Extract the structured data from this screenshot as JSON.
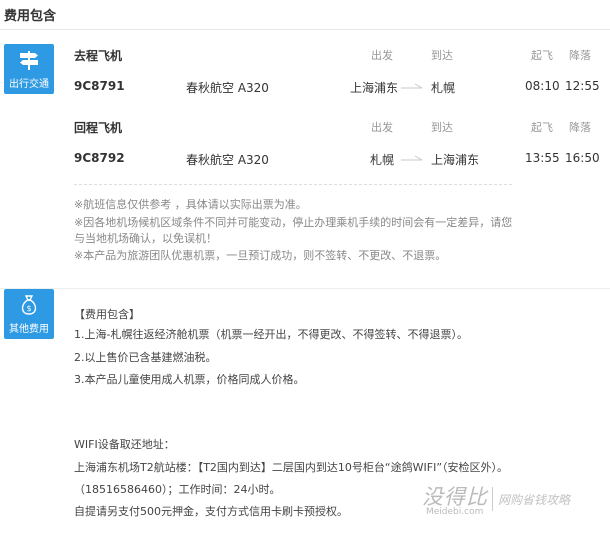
{
  "section": {
    "title": "费用包含"
  },
  "transport": {
    "label": "出行交通",
    "icon": "signpost-icon",
    "color": "#2f9ae4"
  },
  "other_fees": {
    "label": "其他费用",
    "icon": "money-bag-icon",
    "color": "#2f9ae4"
  },
  "columns": {
    "depart": "出发",
    "arrive": "到达",
    "takeoff": "起飞",
    "landing": "降落"
  },
  "outbound": {
    "heading": "去程飞机",
    "flight_no": "9C8791",
    "airline": "春秋航空 A320",
    "from": "上海浦东",
    "to": "札幌",
    "takeoff": "08:10",
    "landing": "12:55"
  },
  "return": {
    "heading": "回程飞机",
    "flight_no": "9C8792",
    "airline": "春秋航空 A320",
    "from": "札幌",
    "to": "上海浦东",
    "takeoff": "13:55",
    "landing": "16:50"
  },
  "notes": [
    "※航班信息仅供参考 ，具体请以实际出票为准。",
    "※因各地机场候机区域条件不同并可能变动，停止办理乘机手续的时间会有一定差异，请您",
    "与当地机场确认，以免误机！",
    "※本产品为旅游团队优惠机票，一旦预订成功，则不签转、不更改、不退票。"
  ],
  "fees": {
    "heading": "【费用包含】",
    "items": [
      "1.上海-札幌往返经济舱机票（机票一经开出，不得更改、不得签转、不得退票）。",
      "2.以上售价已含基建燃油税。",
      "3.本产品儿童使用成人机票，价格同成人价格。"
    ]
  },
  "wifi": {
    "title": "WIFI设备取还地址：",
    "address": "上海浦东机场T2航站楼：【T2国内到达】二层国内到达10号柜台“途鸽WIFI”（安检区外）。",
    "hours": "（18516586460）；工作时间：24小时。",
    "deposit": "自提请另支付500元押金，支付方式信用卡刷卡预授权。"
  },
  "watermark": {
    "brand": "没得比",
    "domain": "Meidebi.com",
    "slogan": "网购省钱攻略"
  }
}
